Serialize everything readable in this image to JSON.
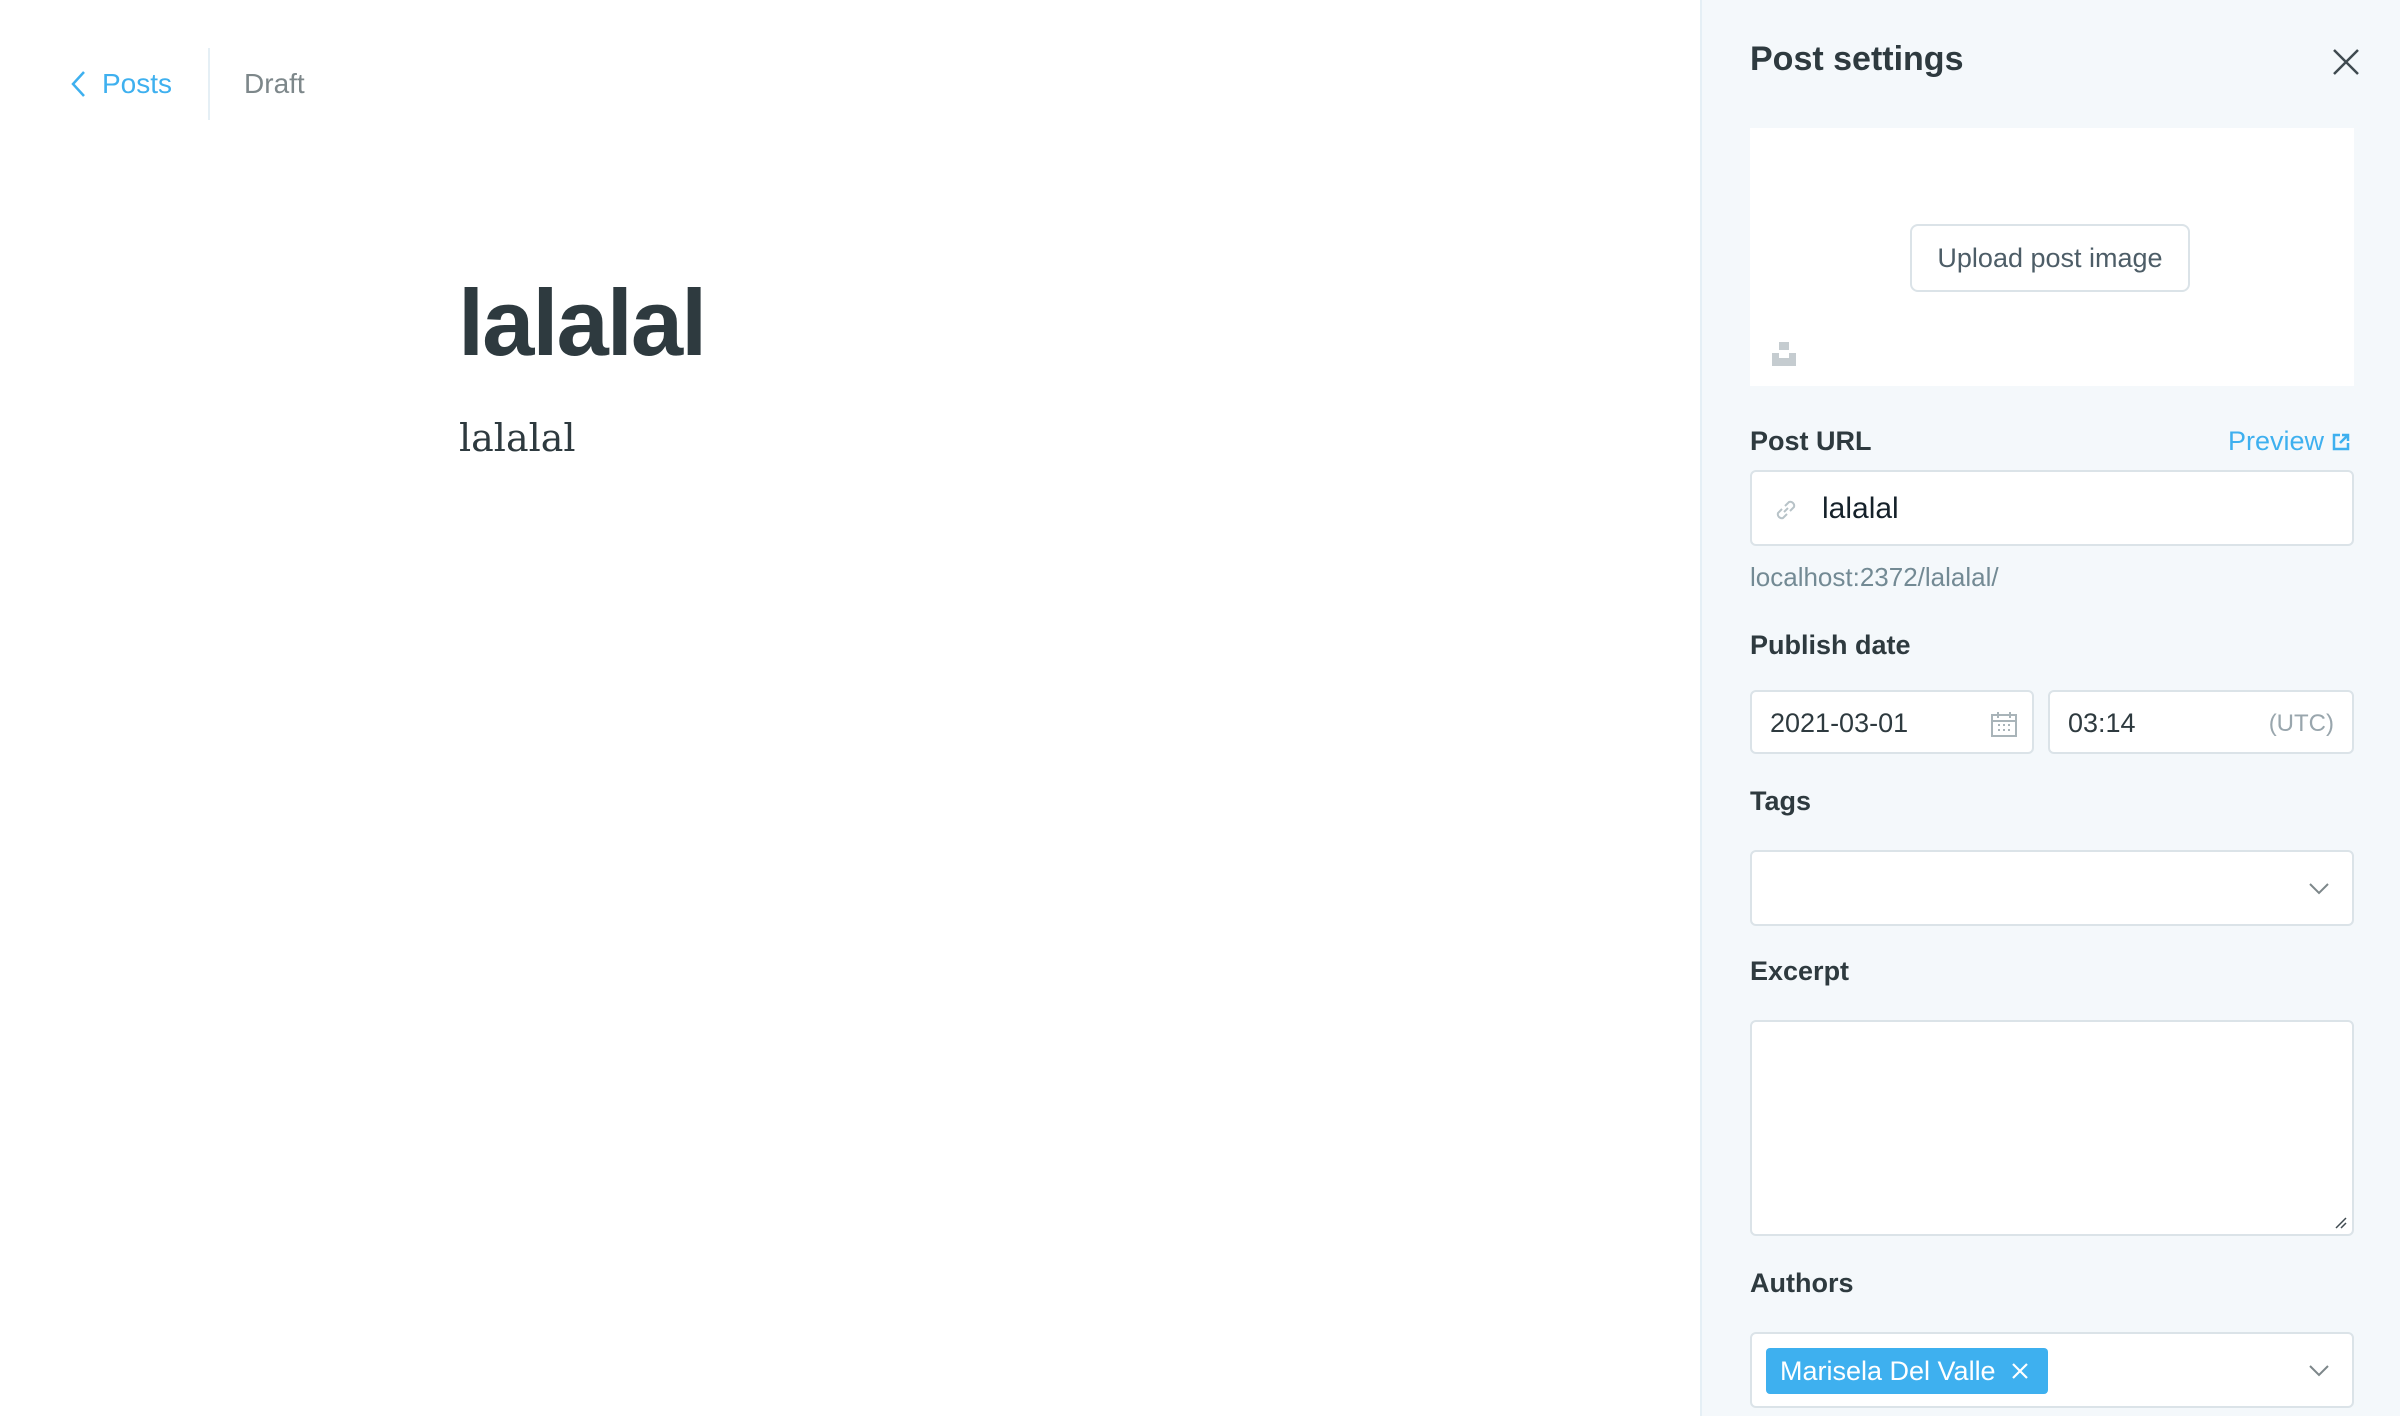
{
  "breadcrumb": {
    "back_label": "Posts",
    "status": "Draft"
  },
  "post": {
    "title": "lalalal",
    "body": "lalalal"
  },
  "settings": {
    "title": "Post settings",
    "upload_label": "Upload post image",
    "post_url": {
      "label": "Post URL",
      "preview_label": "Preview",
      "value": "lalalal",
      "full_url": "localhost:2372/lalalal/"
    },
    "publish_date": {
      "label": "Publish date",
      "date": "2021-03-01",
      "time": "03:14",
      "timezone": "(UTC)"
    },
    "tags": {
      "label": "Tags"
    },
    "excerpt": {
      "label": "Excerpt",
      "value": ""
    },
    "authors": {
      "label": "Authors",
      "selected": [
        "Marisela Del Valle"
      ]
    }
  },
  "colors": {
    "accent": "#3eb0ef",
    "panel_bg": "#f4f8fb",
    "text_dark": "#2e3a3f",
    "muted": "#738a94"
  },
  "icons": [
    "chevron-left-icon",
    "close-icon",
    "unsplash-icon",
    "external-link-icon",
    "link-icon",
    "calendar-icon",
    "chevron-down-icon",
    "token-remove-icon"
  ]
}
